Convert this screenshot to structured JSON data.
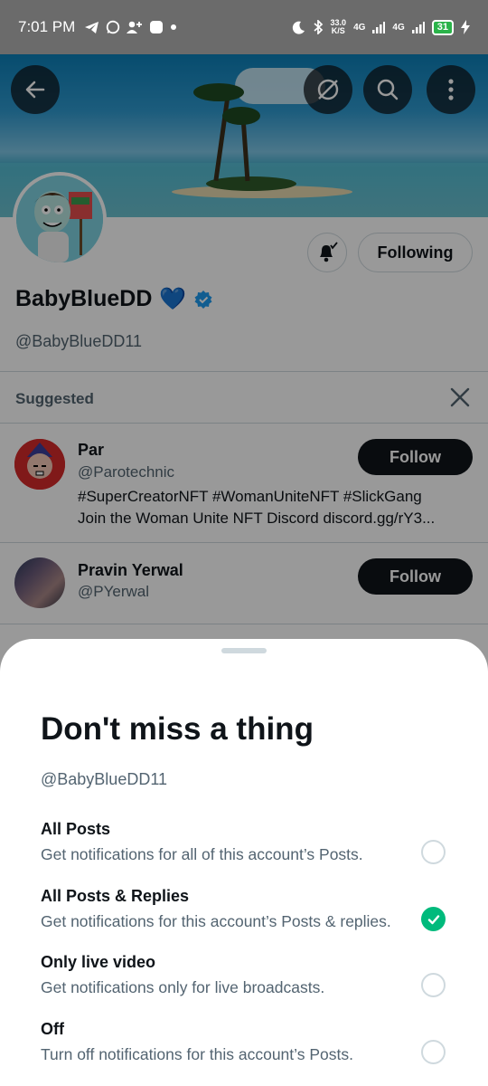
{
  "status_bar": {
    "time": "7:01 PM",
    "net_rate_value": "33.0",
    "net_rate_unit": "K/S",
    "network_1": "4G",
    "network_2": "4G",
    "battery": "31"
  },
  "profile": {
    "display_name": "BabyBlueDD",
    "name_emoji": "💙",
    "handle": "@BabyBlueDD11",
    "following_label": "Following"
  },
  "suggested": {
    "label": "Suggested",
    "items": [
      {
        "name": "Par",
        "handle": "@Parotechnic",
        "bio_line1": "#SuperCreatorNFT #WomanUniteNFT #SlickGang",
        "bio_line2": "Join the Woman Unite NFT Discord discord.gg/rY3...",
        "follow_label": "Follow"
      },
      {
        "name": "Pravin Yerwal",
        "handle": "@PYerwal",
        "follow_label": "Follow"
      }
    ]
  },
  "sheet": {
    "title": "Don't miss a thing",
    "handle": "@BabyBlueDD11",
    "options": [
      {
        "title": "All Posts",
        "desc": "Get notifications for all of this account’s Posts.",
        "selected": false
      },
      {
        "title": "All Posts & Replies",
        "desc": "Get notifications for this account’s Posts & replies.",
        "selected": true
      },
      {
        "title": "Only live video",
        "desc": "Get notifications only for live broadcasts.",
        "selected": false
      },
      {
        "title": "Off",
        "desc": "Turn off notifications for this account’s Posts.",
        "selected": false
      }
    ]
  },
  "colors": {
    "accent_selected": "#00ba7c",
    "verified": "#1d9bf0",
    "primary_text": "#0f1419",
    "secondary_text": "#536471"
  },
  "icons": {
    "back": "arrow-left-icon",
    "unsubscribe": "circle-slash-icon",
    "search": "search-icon",
    "more": "more-vertical-icon",
    "bell": "bell-check-icon",
    "verified": "verified-badge-icon",
    "close": "close-icon",
    "check": "check-icon"
  }
}
